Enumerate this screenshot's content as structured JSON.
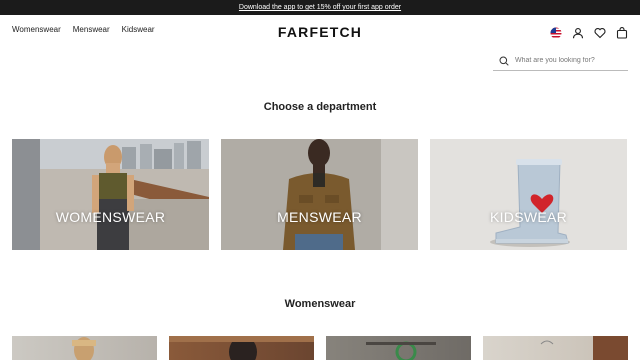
{
  "promo": {
    "text": "Download the app to get 15% off your first app order"
  },
  "header": {
    "logo": "FARFETCH",
    "nav": [
      {
        "label": "Womenswear"
      },
      {
        "label": "Menswear"
      },
      {
        "label": "Kidswear"
      }
    ],
    "icons": [
      "us-flag-icon",
      "account-icon",
      "wishlist-heart-icon",
      "bag-icon"
    ]
  },
  "search": {
    "placeholder": "What are you looking for?"
  },
  "main": {
    "department_heading": "Choose a department",
    "departments": [
      {
        "label": "WOMENSWEAR"
      },
      {
        "label": "MENSWEAR"
      },
      {
        "label": "KIDSWEAR"
      }
    ],
    "section_heading": "Womenswear"
  },
  "colors": {
    "promo_bg": "#1b1b1b",
    "text": "#222222",
    "background": "#ffffff"
  }
}
